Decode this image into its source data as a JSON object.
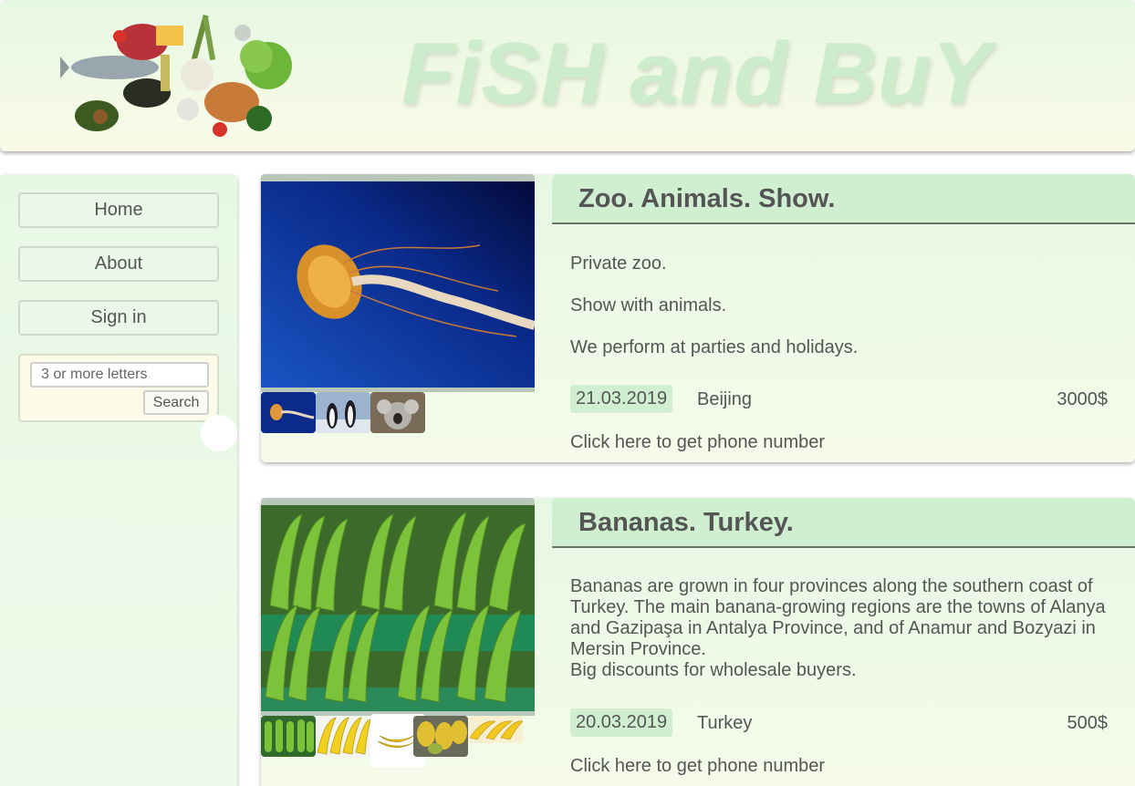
{
  "header": {
    "title": "FiSH and BuY",
    "logo_icon": "groceries-logo-icon"
  },
  "sidebar": {
    "nav": [
      {
        "label": "Home"
      },
      {
        "label": "About"
      },
      {
        "label": "Sign in"
      }
    ],
    "search": {
      "placeholder": "3 or more letters",
      "button_label": "Search"
    }
  },
  "listings": [
    {
      "title": "Zoo. Animals. Show.",
      "description": [
        "Private zoo.",
        "Show with animals.",
        "We perform at parties and holidays."
      ],
      "date": "21.03.2019",
      "location": "Beijing",
      "price": "3000$",
      "phone_link": "Click here to get phone number",
      "main_image_icon": "jellyfish-photo",
      "thumbnails": [
        "jellyfish-thumb",
        "penguins-thumb",
        "koala-thumb"
      ]
    },
    {
      "title": "Bananas. Turkey.",
      "description": "Bananas are grown in four provinces along the southern coast of Turkey. The main banana-growing regions are the towns of Alanya and Gazipaşa in Antalya Province, and of Anamur and Bozyazi in Mersin Province.",
      "description_extra": "Big discounts for wholesale buyers.",
      "date": "20.03.2019",
      "location": "Turkey",
      "price": "500$",
      "phone_link": "Click here to get phone number",
      "main_image_icon": "green-bananas-photo",
      "thumbnails": [
        "green-bananas-thumb",
        "yellow-bananas-thumb",
        "banana-bunch-thumb",
        "market-bananas-thumb",
        "bananas-row-thumb"
      ]
    }
  ],
  "colors": {
    "header_bg": "#e6f8e4",
    "title_color": "#cdeccb",
    "title_bar": "#d0efd1",
    "text": "#555555"
  }
}
